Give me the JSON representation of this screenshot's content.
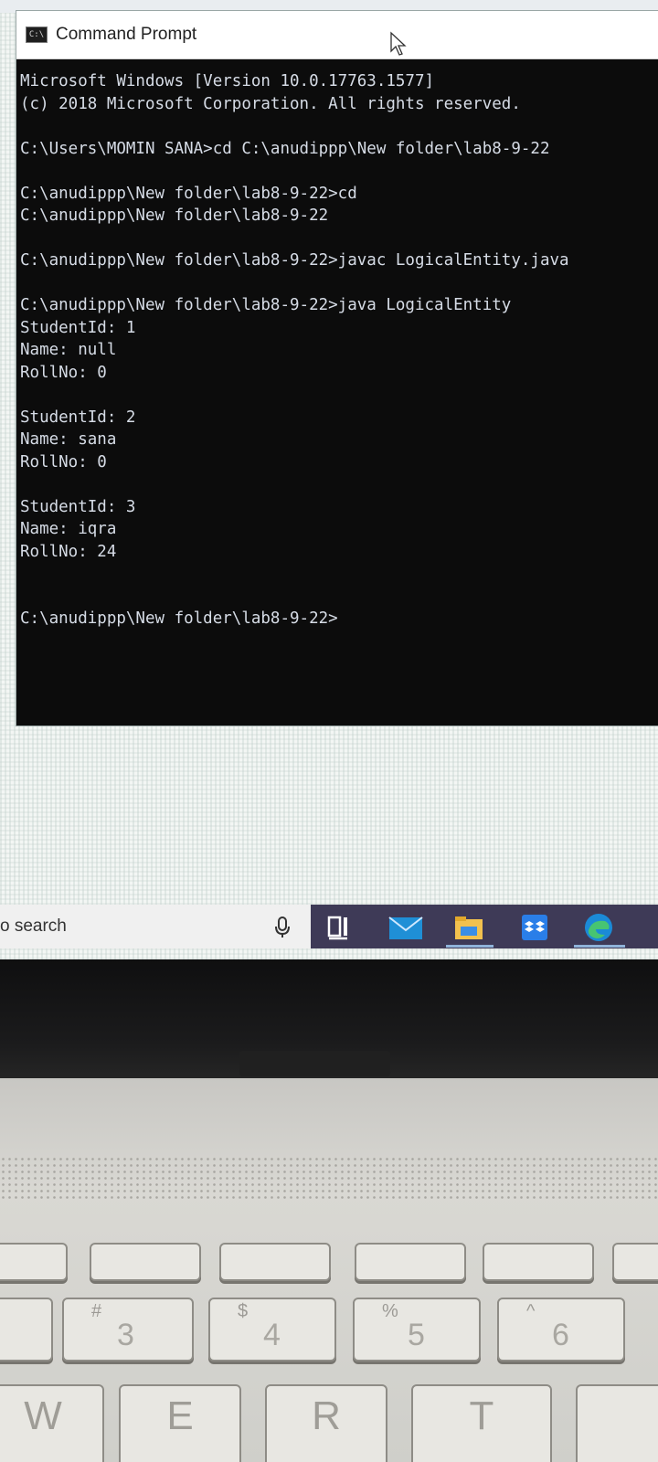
{
  "window": {
    "title": "Command Prompt",
    "icon": "cmd-icon"
  },
  "console": {
    "lines": [
      "Microsoft Windows [Version 10.0.17763.1577]",
      "(c) 2018 Microsoft Corporation. All rights reserved.",
      "",
      "C:\\Users\\MOMIN SANA>cd C:\\anudippp\\New folder\\lab8-9-22",
      "",
      "C:\\anudippp\\New folder\\lab8-9-22>cd",
      "C:\\anudippp\\New folder\\lab8-9-22",
      "",
      "C:\\anudippp\\New folder\\lab8-9-22>javac LogicalEntity.java",
      "",
      "C:\\anudippp\\New folder\\lab8-9-22>java LogicalEntity",
      "StudentId: 1",
      "Name: null",
      "RollNo: 0",
      "",
      "StudentId: 2",
      "Name: sana",
      "RollNo: 0",
      "",
      "StudentId: 3",
      "Name: iqra",
      "RollNo: 24",
      "",
      "",
      "C:\\anudippp\\New folder\\lab8-9-22>"
    ]
  },
  "taskbar": {
    "search_text": "o search",
    "icons": [
      "microphone-icon",
      "task-view-icon",
      "mail-icon",
      "file-explorer-icon",
      "dropbox-icon",
      "edge-icon"
    ]
  },
  "keyboard": {
    "keys": [
      {
        "symbol": "#",
        "number": "3"
      },
      {
        "symbol": "$",
        "number": "4"
      },
      {
        "symbol": "%",
        "number": "5"
      },
      {
        "symbol": "^",
        "number": "6"
      }
    ],
    "letters": [
      "W",
      "E",
      "R",
      "T"
    ]
  },
  "colors": {
    "console_bg": "#0c0c0c",
    "console_text": "#d6dce6",
    "taskbar_bg": "#3e3a57"
  }
}
